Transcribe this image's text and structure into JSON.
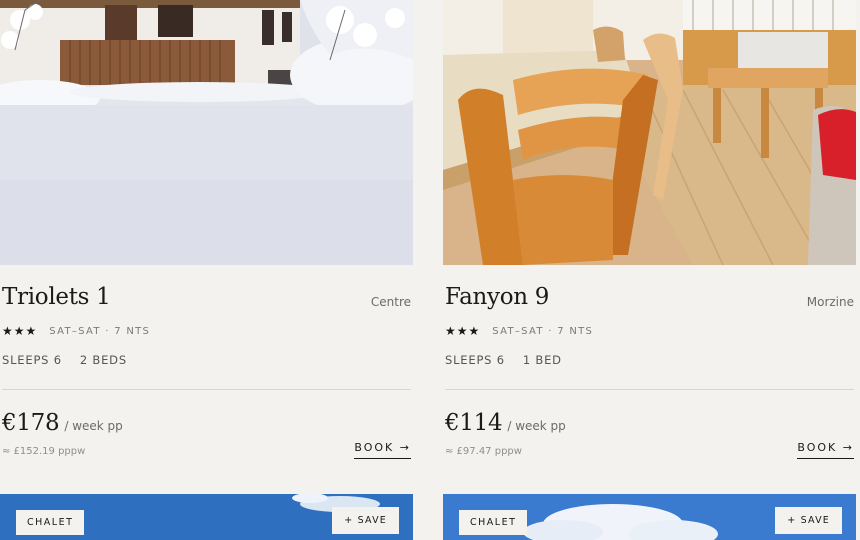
{
  "listings": [
    {
      "name": "Triolets 1",
      "location": "Centre",
      "stars": "★★★",
      "stay": "SAT–SAT · 7 NTS",
      "sleeps": "SLEEPS 6",
      "beds": "2 BEDS",
      "price": "€178",
      "per": "/ week pp",
      "pppw": "≈ £152.19 pppw",
      "book": "BOOK →"
    },
    {
      "name": "Fanyon 9",
      "location": "Morzine",
      "stars": "★★★",
      "stay": "SAT–SAT · 7 NTS",
      "sleeps": "SLEEPS 6",
      "beds": "1 BED",
      "price": "€114",
      "per": "/ week pp",
      "pppw": "≈ £97.47 pppw",
      "book": "BOOK →"
    }
  ],
  "next_row": [
    {
      "badge": "CHALET",
      "save": "+ SAVE"
    },
    {
      "badge": "CHALET",
      "save": "+ SAVE"
    }
  ],
  "colors": {
    "background": "#f4f2ee",
    "text": "#1a1a1a",
    "muted": "#6b6b6b",
    "rule": "#d9d6d0"
  }
}
